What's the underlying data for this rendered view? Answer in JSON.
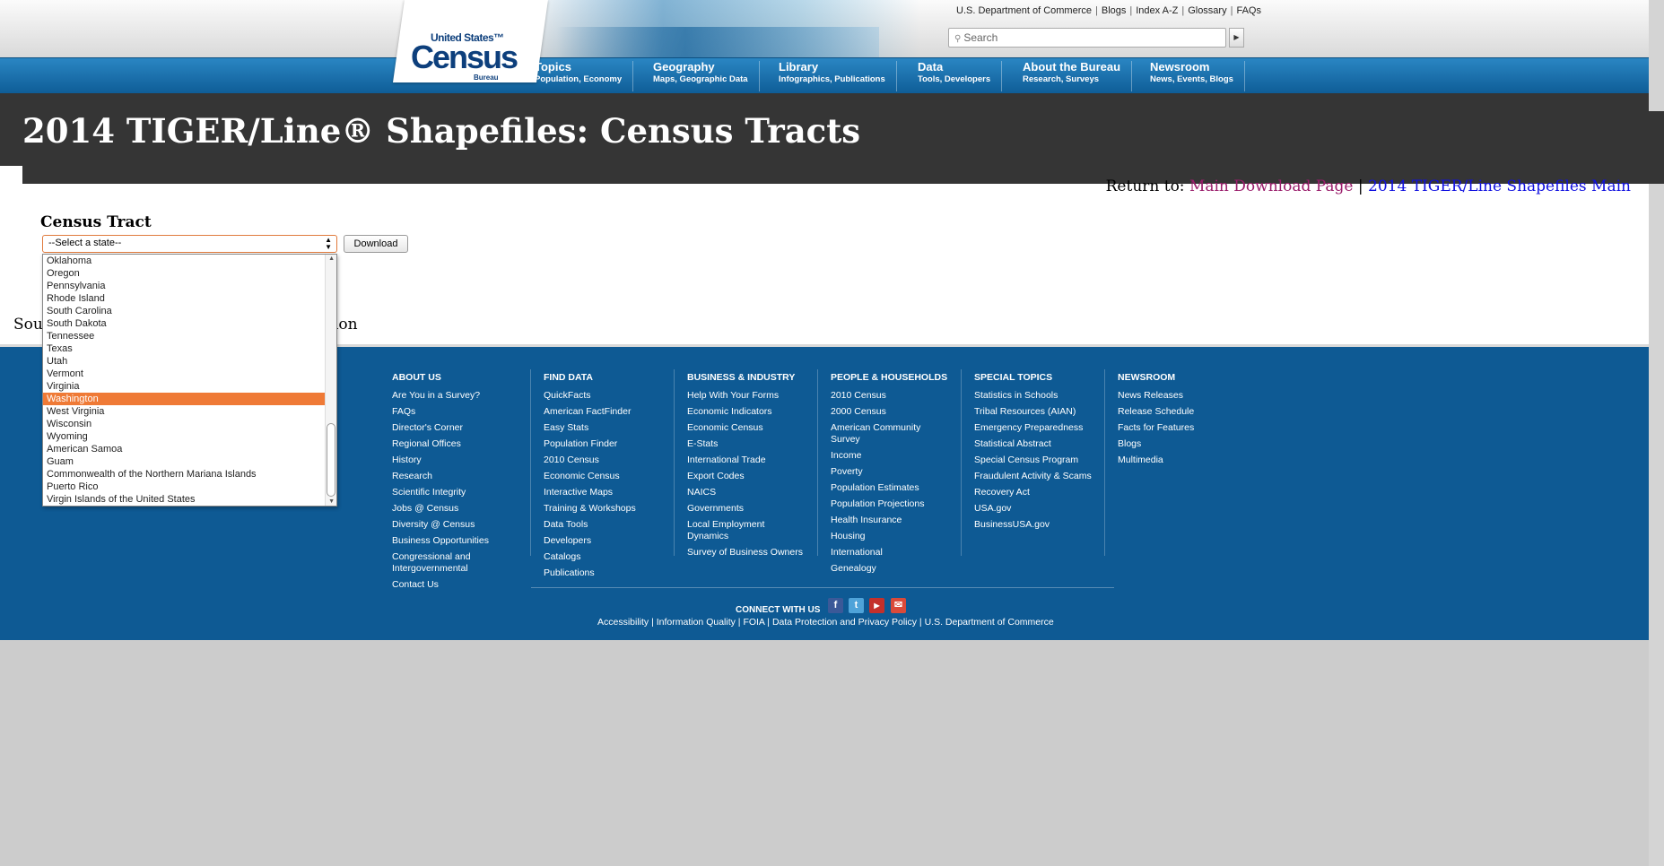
{
  "header": {
    "logo": {
      "line1": "United States™",
      "line2": "Census",
      "line3": "Bureau"
    },
    "util_links": [
      "U.S. Department of Commerce",
      "Blogs",
      "Index A-Z",
      "Glossary",
      "FAQs"
    ],
    "search_placeholder": "Search",
    "nav": [
      {
        "title": "Topics",
        "sub": "Population, Economy"
      },
      {
        "title": "Geography",
        "sub": "Maps, Geographic Data"
      },
      {
        "title": "Library",
        "sub": "Infographics, Publications"
      },
      {
        "title": "Data",
        "sub": "Tools, Developers"
      },
      {
        "title": "About the Bureau",
        "sub": "Research, Surveys"
      },
      {
        "title": "Newsroom",
        "sub": "News, Events, Blogs"
      }
    ]
  },
  "page": {
    "title": "2014 TIGER/Line® Shapefiles: Census Tracts",
    "return_label": "Return to:",
    "return_main": "Main Download Page",
    "return_sep": "|",
    "return_tiger": "2014 TIGER/Line Shapefiles Main",
    "section_heading": "Census Tract",
    "select_value": "--Select a state--",
    "download_label": "Download",
    "source_start": "Sou",
    "source_end": "ion"
  },
  "dropdown": {
    "selected": "Washington",
    "items": [
      "Oklahoma",
      "Oregon",
      "Pennsylvania",
      "Rhode Island",
      "South Carolina",
      "South Dakota",
      "Tennessee",
      "Texas",
      "Utah",
      "Vermont",
      "Virginia",
      "Washington",
      "West Virginia",
      "Wisconsin",
      "Wyoming",
      "American Samoa",
      "Guam",
      "Commonwealth of the Northern Mariana Islands",
      "Puerto Rico",
      "Virgin Islands of the United States"
    ]
  },
  "footer": {
    "columns": [
      {
        "heading": "ABOUT US",
        "links": [
          "Are You in a Survey?",
          "FAQs",
          "Director's Corner",
          "Regional Offices",
          "History",
          "Research",
          "Scientific Integrity",
          "Jobs @ Census",
          "Diversity @ Census",
          "Business Opportunities",
          "Congressional and Intergovernmental",
          "Contact Us"
        ]
      },
      {
        "heading": "FIND DATA",
        "links": [
          "QuickFacts",
          "American FactFinder",
          "Easy Stats",
          "Population Finder",
          "2010 Census",
          "Economic Census",
          "Interactive Maps",
          "Training & Workshops",
          "Data Tools",
          "Developers",
          "Catalogs",
          "Publications"
        ]
      },
      {
        "heading": "BUSINESS & INDUSTRY",
        "links": [
          "Help With Your Forms",
          "Economic Indicators",
          "Economic Census",
          "E-Stats",
          "International Trade",
          "Export Codes",
          "NAICS",
          "Governments",
          "Local Employment Dynamics",
          "Survey of Business Owners"
        ]
      },
      {
        "heading": "PEOPLE & HOUSEHOLDS",
        "links": [
          "2010 Census",
          "2000 Census",
          "American Community Survey",
          "Income",
          "Poverty",
          "Population Estimates",
          "Population Projections",
          "Health Insurance",
          "Housing",
          "International",
          "Genealogy"
        ]
      },
      {
        "heading": "SPECIAL TOPICS",
        "links": [
          "Statistics in Schools",
          "Tribal Resources (AIAN)",
          "Emergency Preparedness",
          "Statistical Abstract",
          "Special Census Program",
          "Fraudulent Activity & Scams",
          "Recovery Act",
          "USA.gov",
          "BusinessUSA.gov"
        ]
      },
      {
        "heading": "NEWSROOM",
        "links": [
          "News Releases",
          "Release Schedule",
          "Facts for Features",
          "Blogs",
          "Multimedia"
        ]
      }
    ],
    "connect_label": "CONNECT WITH US",
    "social": [
      "facebook-icon",
      "twitter-icon",
      "youtube-icon",
      "email-icon"
    ],
    "bottom_links": [
      "Accessibility",
      "Information Quality",
      "FOIA",
      "Data Protection and Privacy Policy",
      "U.S. Department of Commerce"
    ]
  },
  "colors": {
    "nav_blue": "#1a72b0",
    "footer_blue": "#0e5a94",
    "title_bar": "#353535",
    "highlight": "#ef7a36"
  }
}
